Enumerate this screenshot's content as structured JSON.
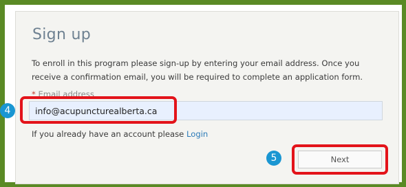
{
  "form": {
    "title": "Sign up",
    "description_line1": "To enroll in this program please sign-up by entering your email address. Once you",
    "description_line2": "receive a confirmation email, you will be required to complete an application form.",
    "email_label_required": "*",
    "email_label": "Email address",
    "email_value": "info@acupuncturealberta.ca",
    "account_prompt": "If you already have an account please",
    "login_link": "Login",
    "next_button": "Next"
  },
  "annotations": {
    "step_email": "4",
    "step_next": "5"
  },
  "colors": {
    "frame_border": "#5a8a25",
    "highlight": "#e3131a",
    "badge": "#1a96d2",
    "input_bg": "#e8f0fe",
    "link": "#2a7ab8",
    "title": "#6e8191"
  }
}
